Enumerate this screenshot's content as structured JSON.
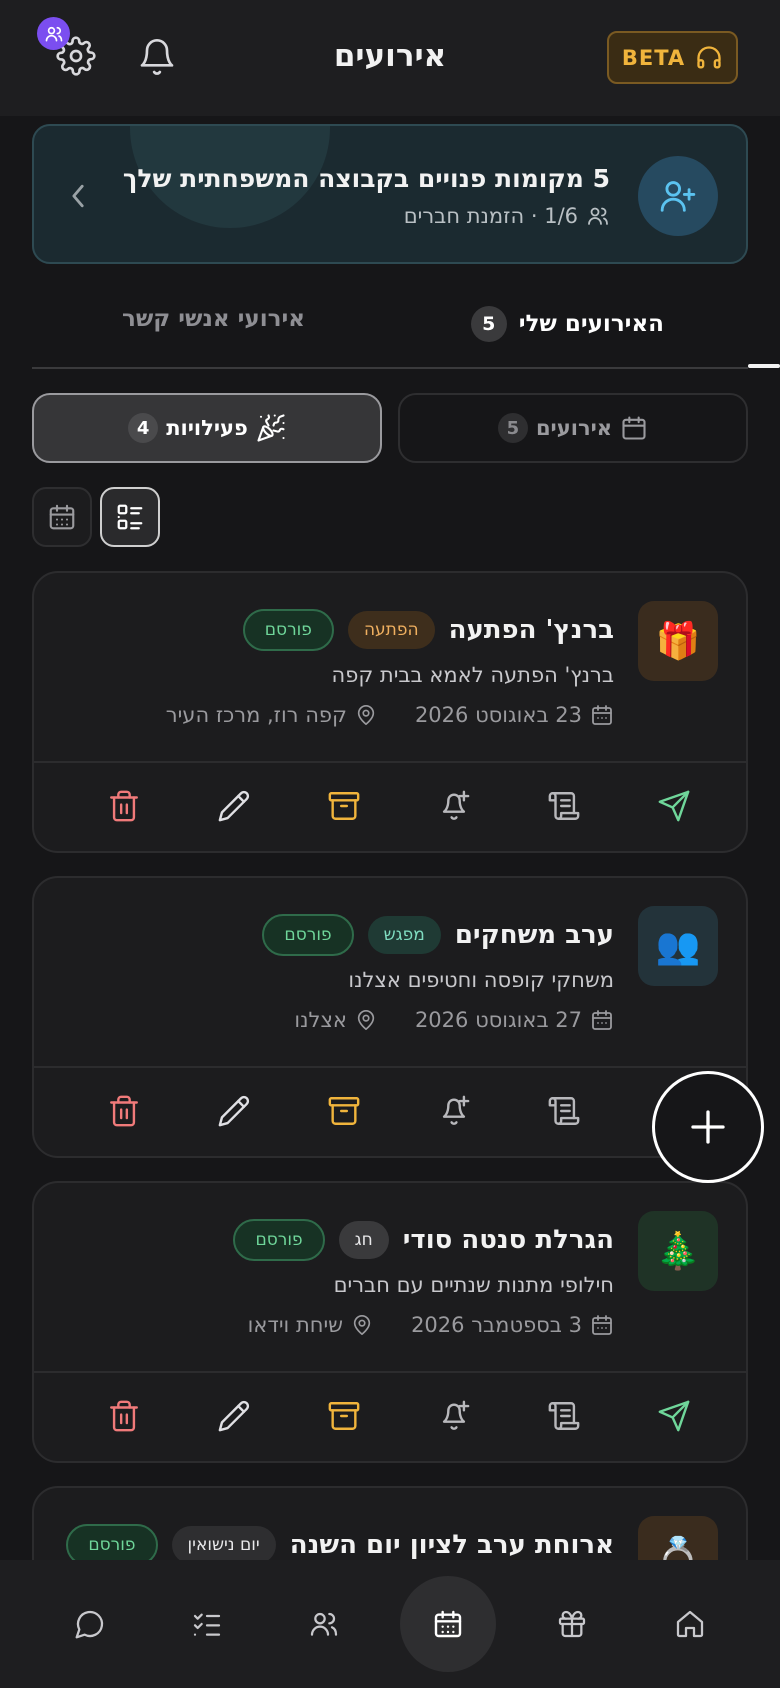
{
  "header": {
    "title": "אירועים",
    "beta_label": "BETA",
    "icons": [
      "users-icon",
      "gear-icon",
      "bell-icon",
      "headset-icon"
    ]
  },
  "invite_banner": {
    "title": "5 מקומות פנויים בקבוצה המשפחתית שלך",
    "subtitle": "1/6 · הזמנת חברים"
  },
  "tabs": [
    {
      "label": "האירועים שלי",
      "count": "5",
      "active": true
    },
    {
      "label": "אירועי אנשי קשר",
      "active": false
    }
  ],
  "segments": [
    {
      "label": "אירועים",
      "count": "5",
      "active": false
    },
    {
      "label": "פעילויות",
      "count": "4",
      "active": true
    }
  ],
  "colors": {
    "accent_green": "#6fd69a",
    "accent_yellow": "#f0b43c",
    "danger_red": "#f07a7a",
    "purple_badge": "#7b4ef0"
  },
  "cards": [
    {
      "icon": "🎁",
      "icon_bg": "#3a2c1e",
      "title": "ברנץ' הפתעה",
      "category": "הפתעה",
      "category_bg": "#3e2e1c",
      "category_color": "#f0b060",
      "status": "פורסם",
      "description": "ברנץ' הפתעה לאמא בבית קפה",
      "date": "23 באוגוסט 2026",
      "location": "קפה רוז, מרכז העיר"
    },
    {
      "icon": "👥",
      "icon_bg": "#23333a",
      "title": "ערב משחקים",
      "category": "מפגש",
      "category_bg": "#1f3a34",
      "category_color": "#7fdcc0",
      "status": "פורסם",
      "description": "משחקי קופסה וחטיפים אצלנו",
      "date": "27 באוגוסט 2026",
      "location": "אצלנו"
    },
    {
      "icon": "🎄",
      "icon_bg": "#1f3326",
      "title": "הגרלת סנטה סודי",
      "category": "חג",
      "category_bg": "#3a3a3c",
      "category_color": "#e8e8ea",
      "status": "פורסם",
      "description": "חילופי מתנות שנתיים עם חברים",
      "date": "3 בספטמבר 2026",
      "location": "שיחת וידאו"
    },
    {
      "icon": "💍",
      "icon_bg": "#3a2c1e",
      "title": "ארוחת ערב לציון יום השנה",
      "category": "יום נישואין",
      "category_bg": "#2e2e30",
      "category_color": "#e8e8ea",
      "status": "פורסם"
    }
  ],
  "card_actions": [
    "send-icon",
    "scroll-icon",
    "bell-plus-icon",
    "archive-icon",
    "pencil-icon",
    "trash-icon"
  ],
  "bottom_nav": [
    "chat-icon",
    "tasks-icon",
    "contacts-icon",
    "calendar-icon",
    "gift-icon",
    "home-icon"
  ]
}
